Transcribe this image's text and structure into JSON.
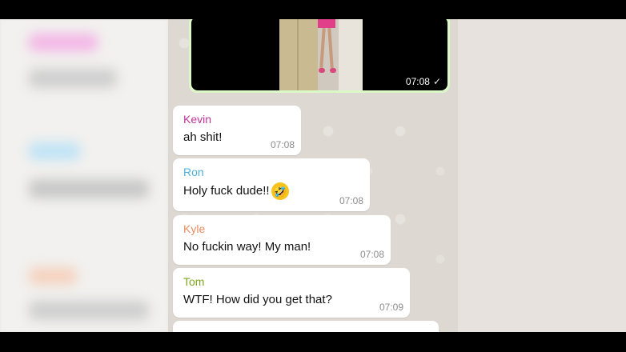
{
  "media_message": {
    "time": "07:08",
    "status_icon": "check-icon"
  },
  "messages": [
    {
      "sender": "Kevin",
      "sender_color": "#c0349a",
      "text": "ah shit!",
      "time": "07:08"
    },
    {
      "sender": "Ron",
      "sender_color": "#4fb1d9",
      "text": "Holy fuck dude!!",
      "emoji": "rolling-on-floor-laughing",
      "time": "07:08"
    },
    {
      "sender": "Kyle",
      "sender_color": "#e88e63",
      "text": "No fuckin way! My man!",
      "time": "07:08"
    },
    {
      "sender": "Tom",
      "sender_color": "#7ea61f",
      "text": "WTF! How did you get that?",
      "time": "07:09"
    }
  ]
}
